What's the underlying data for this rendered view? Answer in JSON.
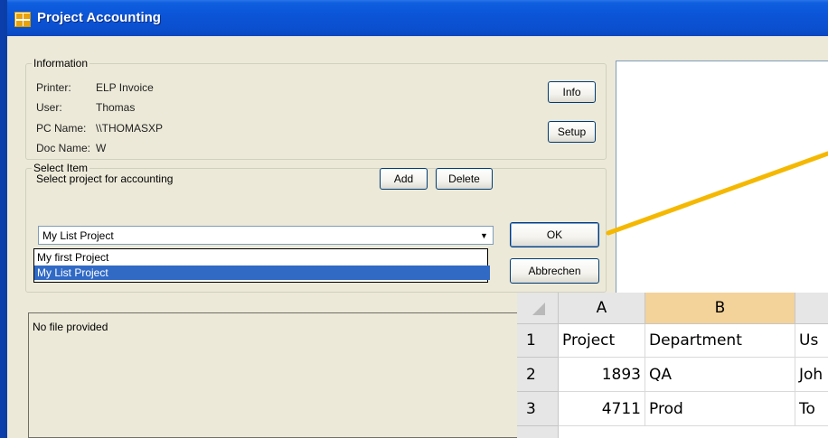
{
  "window": {
    "title": "Project Accounting"
  },
  "information": {
    "group_title": "Information",
    "printer_label": "Printer:",
    "printer_value": "ELP Invoice",
    "user_label": "User:",
    "user_value": "Thomas",
    "pc_label": "PC Name:",
    "pc_value": "\\\\THOMASXP",
    "doc_label": "Doc Name:",
    "doc_value": "W",
    "info_button": "Info",
    "setup_button": "Setup"
  },
  "select_item": {
    "group_title": "Select Item",
    "instruction": "Select project for accounting",
    "add_button": "Add",
    "delete_button": "Delete",
    "combo_value": "My List Project",
    "options": [
      "My first Project",
      "My List Project"
    ],
    "selected_index": 1,
    "ok_button": "OK",
    "cancel_button": "Abbrechen"
  },
  "file_panel": {
    "text": "No file provided"
  },
  "spreadsheet": {
    "columns": [
      "A",
      "B",
      ""
    ],
    "rows": [
      {
        "num": "1",
        "a": "Project",
        "b": "Department",
        "c": "Us"
      },
      {
        "num": "2",
        "a": "1893",
        "b": "QA",
        "c": "Joh"
      },
      {
        "num": "3",
        "a": "4711",
        "b": "Prod",
        "c": "To"
      }
    ]
  },
  "colors": {
    "arrow": "#f5b800",
    "selection": "#316ac5",
    "title_bar": "#0b55d8"
  }
}
